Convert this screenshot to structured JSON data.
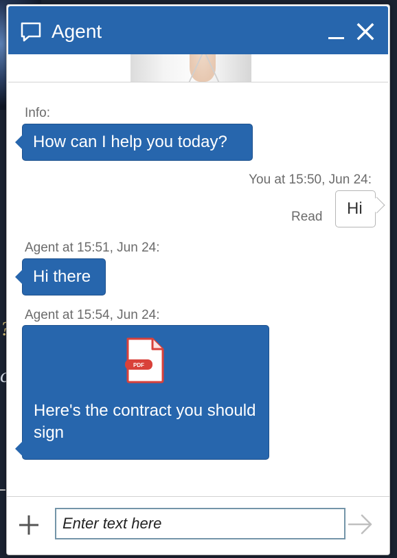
{
  "window": {
    "title": "Agent",
    "icons": {
      "title": "chat-bubble-icon",
      "minimize": "minimize-icon",
      "close": "close-icon"
    }
  },
  "avatar": {
    "icon": "agent-avatar"
  },
  "messages": [
    {
      "meta": "Info:",
      "sender": "agent",
      "text": "How can I help you today?"
    },
    {
      "meta": "You at 15:50, Jun 24:",
      "sender": "user",
      "text": "Hi",
      "status": "Read"
    },
    {
      "meta": "Agent at 15:51, Jun 24:",
      "sender": "agent",
      "text": "Hi there"
    },
    {
      "meta": "Agent at 15:54, Jun 24:",
      "sender": "agent",
      "attachment": {
        "type": "PDF",
        "icon": "pdf-file-icon"
      },
      "text": "Here's the contract you should sign"
    }
  ],
  "composer": {
    "placeholder": "Enter text here",
    "value": "",
    "icons": {
      "add": "plus-icon",
      "send": "send-arrow-icon"
    }
  },
  "colors": {
    "accent": "#2766ad",
    "pdf_red": "#d9413a",
    "input_border": "#7394a8",
    "meta_text": "#6b6b6b"
  }
}
